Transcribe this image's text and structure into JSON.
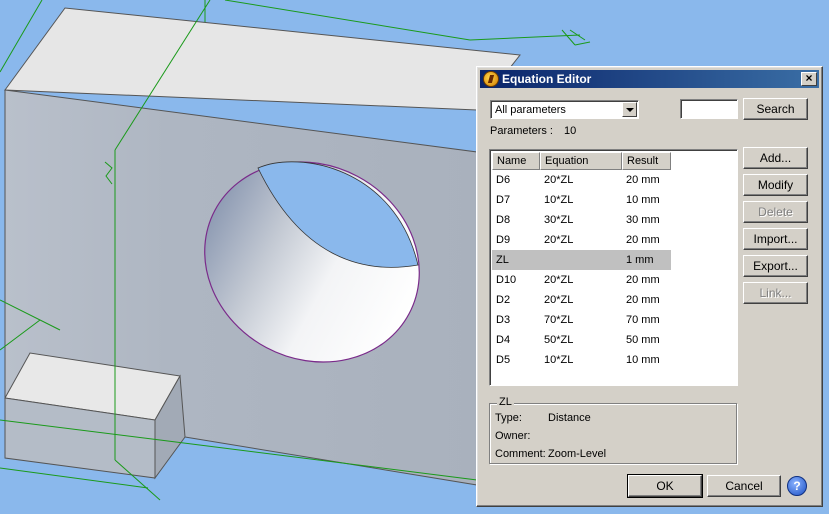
{
  "dialog": {
    "title": "Equation Editor",
    "close_label": "×"
  },
  "filter": {
    "selected": "All parameters",
    "search_value": "",
    "search_button": "Search"
  },
  "parameters": {
    "label": "Parameters :",
    "count": "10"
  },
  "table": {
    "headers": [
      "Name",
      "Equation",
      "Result"
    ],
    "rows": [
      {
        "name": "D6",
        "equation": "20*ZL",
        "result": "20 mm"
      },
      {
        "name": "D7",
        "equation": "10*ZL",
        "result": "10 mm"
      },
      {
        "name": "D8",
        "equation": "30*ZL",
        "result": "30 mm"
      },
      {
        "name": "D9",
        "equation": "20*ZL",
        "result": "20 mm"
      },
      {
        "name": "ZL",
        "equation": "",
        "result": "1 mm",
        "selected": true
      },
      {
        "name": "D10",
        "equation": "20*ZL",
        "result": "20 mm"
      },
      {
        "name": "D2",
        "equation": "20*ZL",
        "result": "20 mm"
      },
      {
        "name": "D3",
        "equation": "70*ZL",
        "result": "70 mm"
      },
      {
        "name": "D4",
        "equation": "50*ZL",
        "result": "50 mm"
      },
      {
        "name": "D5",
        "equation": "10*ZL",
        "result": "10 mm"
      }
    ]
  },
  "side_buttons": {
    "add": "Add...",
    "modify": "Modify",
    "delete": "Delete",
    "import": "Import...",
    "export": "Export...",
    "link": "Link..."
  },
  "details": {
    "legend": "ZL",
    "type_label": "Type:",
    "type_value": "Distance",
    "owner_label": "Owner:",
    "owner_value": "",
    "comment_label": "Comment:",
    "comment_value": "Zoom-Level"
  },
  "footer": {
    "ok": "OK",
    "cancel": "Cancel",
    "help": "?"
  },
  "colors": {
    "viewport_bg": "#8ab8ec",
    "titlebar_start": "#0a246a",
    "dialog_bg": "#d4d0c8",
    "selected_row": "#c0c0c0"
  }
}
